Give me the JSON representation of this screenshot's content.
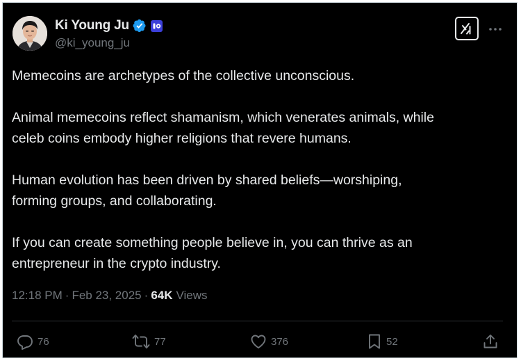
{
  "author": {
    "display_name": "Ki Young Ju",
    "handle": "@ki_young_ju",
    "verified_icon": "verified-badge-icon",
    "affiliation_icon": "cryptoquant-affiliate-icon"
  },
  "header_actions": {
    "grok_icon": "grok-icon",
    "more_icon": "more-horizontal-icon"
  },
  "tweet": {
    "paragraphs": [
      "Memecoins are archetypes of the collective unconscious.",
      "Animal memecoins reflect shamanism, which venerates animals, while",
      "celeb coins embody higher religions that revere humans.",
      "Human evolution has been driven by shared beliefs—worshiping,",
      "forming groups, and collaborating.",
      "If you can create something people believe in, you can thrive as an",
      "entrepreneur in the crypto industry."
    ]
  },
  "meta": {
    "time": "12:18 PM",
    "separator_1": "·",
    "date": "Feb 23, 2025",
    "separator_2": "·",
    "views_count": "64K",
    "views_label": "Views"
  },
  "actions": {
    "reply_count": "76",
    "retweet_count": "77",
    "like_count": "376",
    "bookmark_count": "52",
    "share_icon": "share-icon"
  },
  "colors": {
    "background": "#000000",
    "text_primary": "#e7e9ea",
    "text_secondary": "#71767b",
    "verified_blue": "#1d9bf0",
    "divider": "#2f3336"
  }
}
